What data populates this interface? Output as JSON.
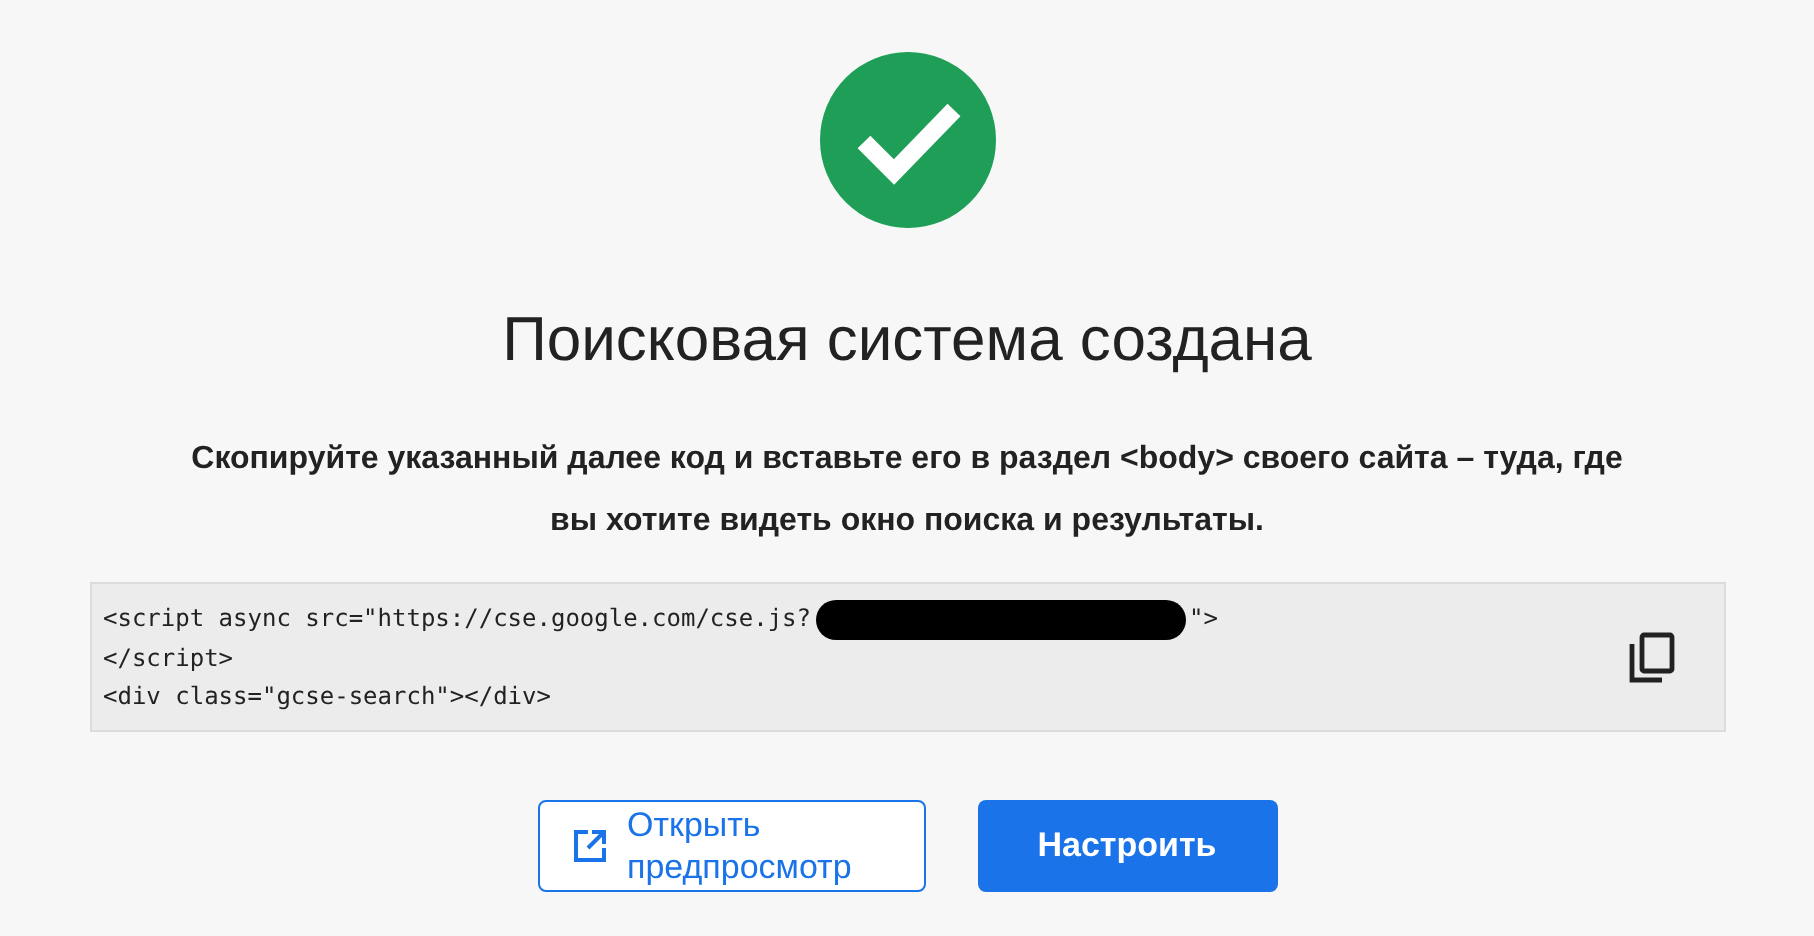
{
  "title": "Поисковая система создана",
  "description": "Скопируйте указанный далее код и вставьте его в раздел <body> своего сайта – туда, где вы хотите видеть окно поиска и результаты.",
  "code_lines": [
    {
      "text": "<script async src=\"https://cse.google.com/cse.js?",
      "redacted": true,
      "tail": "\">"
    },
    {
      "text": "</script>",
      "redacted": false
    },
    {
      "text": "<div class=\"gcse-search\"></div>",
      "redacted": false
    }
  ],
  "buttons": [
    {
      "label": "Открыть предпросмотр",
      "kind": "outline"
    },
    {
      "label": "Настроить",
      "kind": "primary"
    }
  ]
}
